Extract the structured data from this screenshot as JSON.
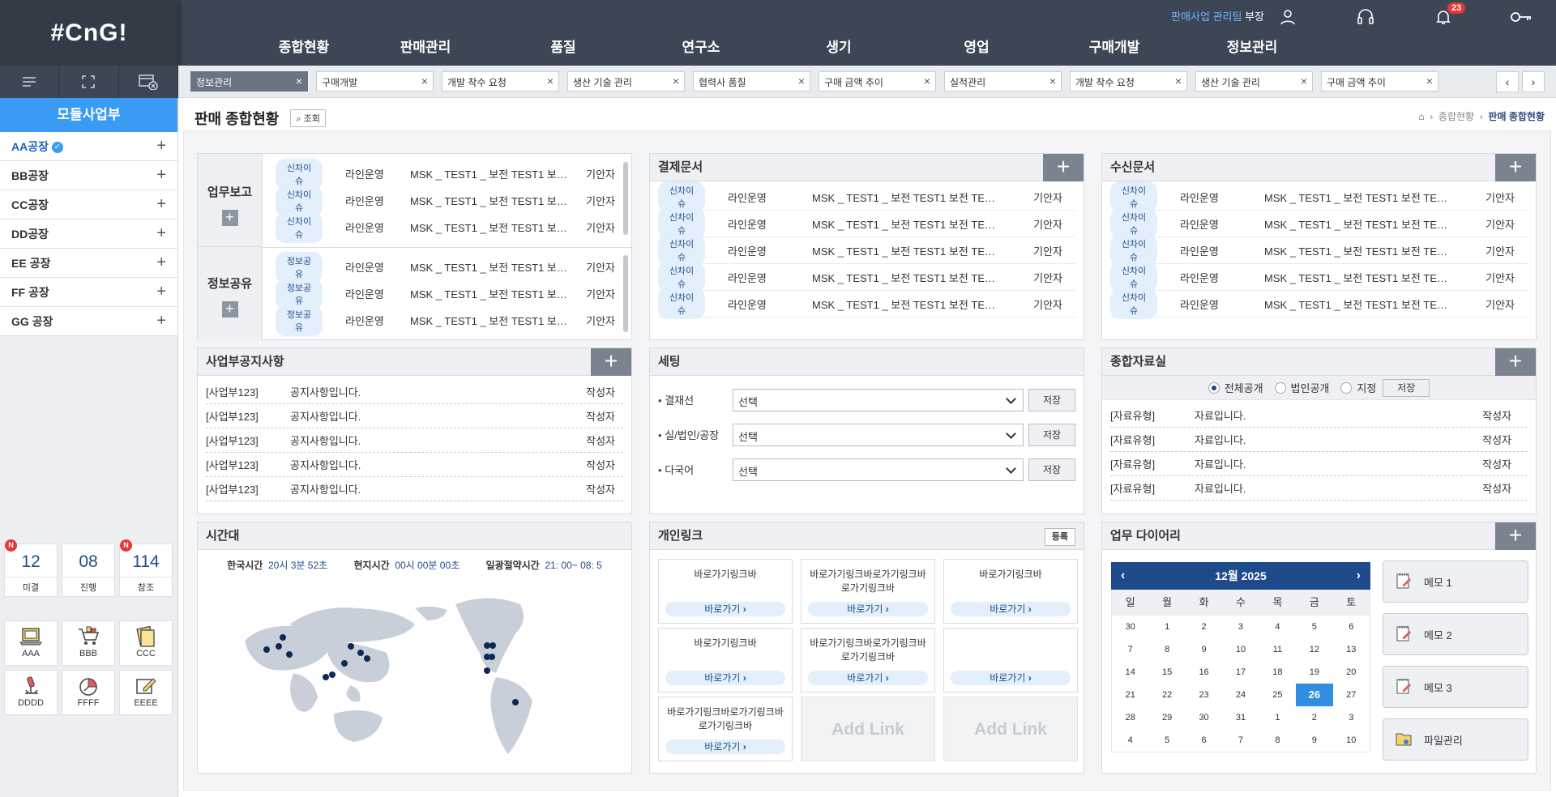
{
  "brand": {
    "logo": "#CnG!"
  },
  "header": {
    "dept": "판매사업 관리팀",
    "role": "부장",
    "notif_count": "23",
    "menu": [
      "종합현황",
      "판매관리",
      "품질",
      "연구소",
      "생기",
      "영업",
      "구매개발",
      "정보관리"
    ]
  },
  "tabs": [
    {
      "label": "정보관리",
      "active": true
    },
    {
      "label": "구매개발"
    },
    {
      "label": "개발 착수 요청"
    },
    {
      "label": "생산 기술 관리"
    },
    {
      "label": "협력사 품질"
    },
    {
      "label": "구매 금액 추이"
    },
    {
      "label": "실적관리"
    },
    {
      "label": "개발 착수 요청"
    },
    {
      "label": "생산 기술 관리"
    },
    {
      "label": "구매 금액 추이"
    }
  ],
  "sidebar": {
    "title": "모듈사업부",
    "items": [
      "AA공장",
      "BB공장",
      "CC공장",
      "DD공장",
      "EE 공장",
      "FF 공장",
      "GG 공장"
    ],
    "stats": [
      {
        "num": "12",
        "label": "미결",
        "new": "N"
      },
      {
        "num": "08",
        "label": "진행"
      },
      {
        "num": "114",
        "label": "참조",
        "new": "N"
      }
    ],
    "apps": [
      "AAA",
      "BBB",
      "CCC",
      "DDDD",
      "FFFF",
      "EEEE"
    ]
  },
  "page": {
    "title": "판매 종합현황",
    "search_label": "조회",
    "breadcrumb": [
      "종합현황",
      "판매 종합현황"
    ]
  },
  "work": {
    "report_label": "업무보고",
    "share_label": "정보공유",
    "report_rows": [
      {
        "tag": "신차이슈",
        "type": "라인운영",
        "title": "MSK _ TEST1 _ 보전 TEST1 보…",
        "who": "기안자"
      },
      {
        "tag": "신차이슈",
        "type": "라인운영",
        "title": "MSK _ TEST1 _ 보전 TEST1 보…",
        "who": "기안자"
      },
      {
        "tag": "신차이슈",
        "type": "라인운영",
        "title": "MSK _ TEST1 _ 보전 TEST1 보…",
        "who": "기안자"
      }
    ],
    "share_rows": [
      {
        "tag": "정보공유",
        "type": "라인운영",
        "title": "MSK _ TEST1 _ 보전 TEST1 보…",
        "who": "기안자"
      },
      {
        "tag": "정보공유",
        "type": "라인운영",
        "title": "MSK _ TEST1 _ 보전 TEST1 보…",
        "who": "기안자"
      },
      {
        "tag": "정보공유",
        "type": "라인운영",
        "title": "MSK _ TEST1 _ 보전 TEST1 보…",
        "who": "기안자"
      }
    ]
  },
  "approval": {
    "title": "결제문서",
    "rows": [
      {
        "tag": "신차이슈",
        "type": "라인운영",
        "title": "MSK _ TEST1 _ 보전 TEST1 보전 TE…",
        "who": "기안자"
      },
      {
        "tag": "신차이슈",
        "type": "라인운영",
        "title": "MSK _ TEST1 _ 보전 TEST1 보전 TE…",
        "who": "기안자"
      },
      {
        "tag": "신차이슈",
        "type": "라인운영",
        "title": "MSK _ TEST1 _ 보전 TEST1 보전 TE…",
        "who": "기안자"
      },
      {
        "tag": "신차이슈",
        "type": "라인운영",
        "title": "MSK _ TEST1 _ 보전 TEST1 보전 TE…",
        "who": "기안자"
      },
      {
        "tag": "신차이슈",
        "type": "라인운영",
        "title": "MSK _ TEST1 _ 보전 TEST1 보전 TE…",
        "who": "기안자"
      }
    ]
  },
  "received": {
    "title": "수신문서",
    "rows": [
      {
        "tag": "신차이슈",
        "type": "라인운영",
        "title": "MSK _ TEST1 _ 보전 TEST1 보전 TE…",
        "who": "기안자"
      },
      {
        "tag": "신차이슈",
        "type": "라인운영",
        "title": "MSK _ TEST1 _ 보전 TEST1 보전 TE…",
        "who": "기안자"
      },
      {
        "tag": "신차이슈",
        "type": "라인운영",
        "title": "MSK _ TEST1 _ 보전 TEST1 보전 TE…",
        "who": "기안자"
      },
      {
        "tag": "신차이슈",
        "type": "라인운영",
        "title": "MSK _ TEST1 _ 보전 TEST1 보전 TE…",
        "who": "기안자"
      },
      {
        "tag": "신차이슈",
        "type": "라인운영",
        "title": "MSK _ TEST1 _ 보전 TEST1 보전 TE…",
        "who": "기안자"
      }
    ]
  },
  "notice": {
    "title": "사업부공지사항",
    "rows": [
      {
        "dept": "[사업부123]",
        "text": "공지사항입니다.",
        "who": "작성자"
      },
      {
        "dept": "[사업부123]",
        "text": "공지사항입니다.",
        "who": "작성자"
      },
      {
        "dept": "[사업부123]",
        "text": "공지사항입니다.",
        "who": "작성자"
      },
      {
        "dept": "[사업부123]",
        "text": "공지사항입니다.",
        "who": "작성자"
      },
      {
        "dept": "[사업부123]",
        "text": "공지사항입니다.",
        "who": "작성자"
      }
    ]
  },
  "settings": {
    "title": "세팅",
    "rows": [
      {
        "label": "결재선",
        "value": "선택",
        "save": "저장"
      },
      {
        "label": "실/법인/공장",
        "value": "선택",
        "save": "저장"
      },
      {
        "label": "다국어",
        "value": "선택",
        "save": "저장"
      }
    ]
  },
  "library": {
    "title": "종합자료실",
    "radios": [
      {
        "label": "전체공개",
        "checked": true
      },
      {
        "label": "법인공개"
      },
      {
        "label": "지정"
      }
    ],
    "save": "저장",
    "rows": [
      {
        "type": "[자료유형]",
        "text": "자료입니다.",
        "who": "작성자"
      },
      {
        "type": "[자료유형]",
        "text": "자료입니다.",
        "who": "작성자"
      },
      {
        "type": "[자료유형]",
        "text": "자료입니다.",
        "who": "작성자"
      },
      {
        "type": "[자료유형]",
        "text": "자료입니다.",
        "who": "작성자"
      }
    ]
  },
  "timezone": {
    "title": "시간대",
    "korea_label": "한국시간",
    "korea_value": "20시 3분 52초",
    "local_label": "현지시간",
    "local_value": "00시 00분 00초",
    "dst_label": "일광절약시간",
    "dst_value": "21: 00~ 08: 5"
  },
  "links": {
    "title": "개인링크",
    "register": "등록",
    "items": [
      {
        "text": "바로가기링크바",
        "go": "바로가기"
      },
      {
        "text": "바로가기링크바로가기링크바로가기링크바",
        "go": "바로가기"
      },
      {
        "text": "바로가기링크바",
        "go": "바로가기"
      },
      {
        "text": "바로가기링크바",
        "go": "바로가기"
      },
      {
        "text": "바로가기링크바로가기링크바로가기링크바",
        "go": "바로가기"
      },
      {
        "text": "",
        "go": "바로가기"
      },
      {
        "text": "바로가기링크바로가기링크바로가기링크바",
        "go": "바로가기"
      }
    ],
    "add_label": "Add Link"
  },
  "diary": {
    "title": "업무 다이어리",
    "month": "12월 2025",
    "weekdays": [
      "일",
      "월",
      "화",
      "수",
      "목",
      "금",
      "토"
    ],
    "days": [
      30,
      1,
      2,
      3,
      4,
      5,
      6,
      7,
      8,
      9,
      10,
      11,
      12,
      13,
      14,
      15,
      16,
      17,
      18,
      19,
      20,
      21,
      22,
      23,
      24,
      25,
      26,
      27,
      28,
      29,
      30,
      31,
      1,
      2,
      3,
      4,
      5,
      6,
      7,
      8,
      9,
      10
    ],
    "selected": 26,
    "memos": [
      "메모 1",
      "메모 2",
      "메모 3",
      "파일관리"
    ]
  },
  "colors": {
    "accent": "#3a9bf4",
    "header": "#3d4655",
    "navy": "#1e4a8c"
  }
}
